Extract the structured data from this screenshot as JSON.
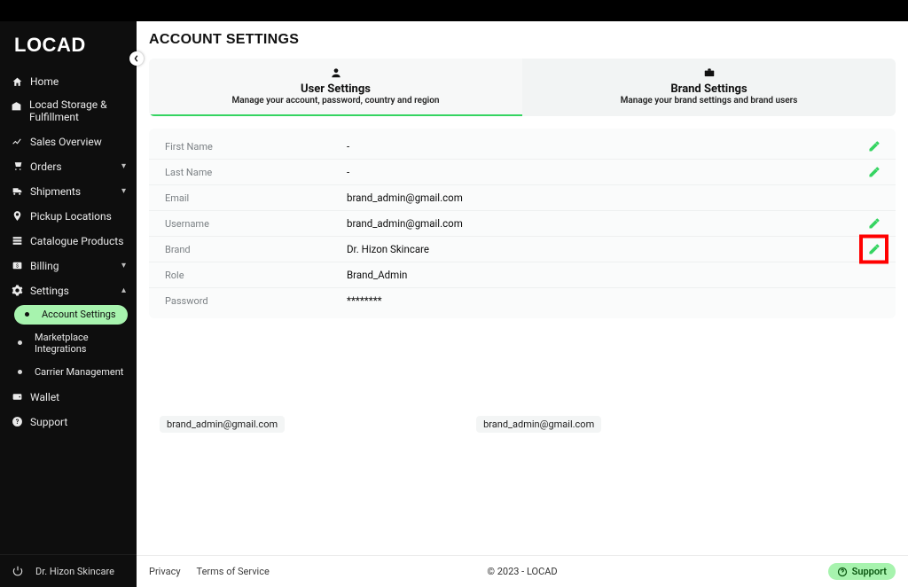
{
  "logo": "LOCAD",
  "sidebar": {
    "items": [
      {
        "label": "Home"
      },
      {
        "label": "Locad Storage & Fulfillment"
      },
      {
        "label": "Sales Overview"
      },
      {
        "label": "Orders"
      },
      {
        "label": "Shipments"
      },
      {
        "label": "Pickup Locations"
      },
      {
        "label": "Catalogue Products"
      },
      {
        "label": "Billing"
      },
      {
        "label": "Settings"
      },
      {
        "label": "Wallet"
      },
      {
        "label": "Support"
      }
    ],
    "settings_sub": [
      {
        "label": "Account Settings"
      },
      {
        "label": "Marketplace Integrations"
      },
      {
        "label": "Carrier Management"
      }
    ],
    "brand_name": "Dr. Hizon Skincare"
  },
  "page": {
    "title": "ACCOUNT SETTINGS"
  },
  "tabs": {
    "user": {
      "title": "User Settings",
      "sub": "Manage your account, password, country and region"
    },
    "brand": {
      "title": "Brand Settings",
      "sub": "Manage your brand settings and brand users"
    }
  },
  "fields": {
    "first_name": {
      "label": "First Name",
      "value": "-"
    },
    "last_name": {
      "label": "Last Name",
      "value": "-"
    },
    "email": {
      "label": "Email",
      "value": "brand_admin@gmail.com"
    },
    "username": {
      "label": "Username",
      "value": "brand_admin@gmail.com"
    },
    "brand": {
      "label": "Brand",
      "value": "Dr. Hizon Skincare"
    },
    "role": {
      "label": "Role",
      "value": "Brand_Admin"
    },
    "password": {
      "label": "Password",
      "value": "********"
    }
  },
  "suggestions": {
    "a": "brand_admin@gmail.com",
    "b": "brand_admin@gmail.com"
  },
  "footer": {
    "privacy": "Privacy",
    "terms": "Terms of Service",
    "copyright": "© 2023 - LOCAD",
    "support": "Support"
  }
}
